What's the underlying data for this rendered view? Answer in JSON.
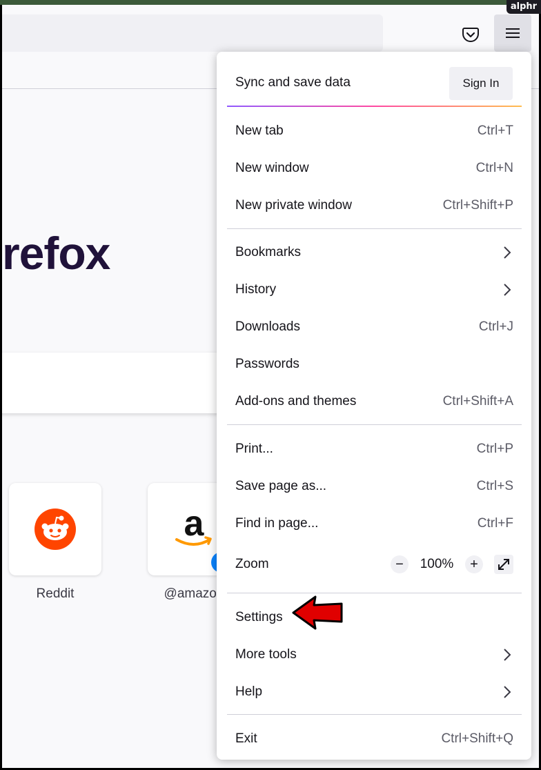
{
  "watermark": "alphr",
  "page": {
    "logo_text": "refox",
    "tiles": [
      {
        "label": "Reddit",
        "icon": "reddit-icon",
        "color": "#ff4500"
      },
      {
        "label": "@amazon",
        "icon": "amazon-icon",
        "color": "#ff9900"
      }
    ]
  },
  "menu": {
    "sync_title": "Sync and save data",
    "sign_in": "Sign In",
    "items": [
      {
        "label": "New tab",
        "shortcut": "Ctrl+T"
      },
      {
        "label": "New window",
        "shortcut": "Ctrl+N"
      },
      {
        "label": "New private window",
        "shortcut": "Ctrl+Shift+P"
      },
      {
        "label": "Bookmarks",
        "icon": "chevron-right-icon"
      },
      {
        "label": "History",
        "icon": "chevron-right-icon"
      },
      {
        "label": "Downloads",
        "shortcut": "Ctrl+J"
      },
      {
        "label": "Passwords"
      },
      {
        "label": "Add-ons and themes",
        "shortcut": "Ctrl+Shift+A"
      },
      {
        "label": "Print...",
        "shortcut": "Ctrl+P"
      },
      {
        "label": "Save page as...",
        "shortcut": "Ctrl+S"
      },
      {
        "label": "Find in page...",
        "shortcut": "Ctrl+F"
      },
      {
        "label": "Zoom"
      },
      {
        "label": "Settings"
      },
      {
        "label": "More tools",
        "icon": "chevron-right-icon"
      },
      {
        "label": "Help",
        "icon": "chevron-right-icon"
      },
      {
        "label": "Exit",
        "shortcut": "Ctrl+Shift+Q"
      }
    ],
    "zoom": {
      "minus": "−",
      "value": "100%",
      "plus": "+"
    }
  },
  "colors": {
    "annotation_arrow": "#e00000",
    "accent_gradient": [
      "#9059ff",
      "#ff4aa2",
      "#ffbd4f"
    ]
  }
}
